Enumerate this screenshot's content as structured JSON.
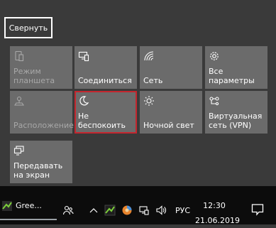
{
  "collapse_label": "Свернуть",
  "tiles": [
    {
      "label": "Режим планшета",
      "icon": "tablet-mode-icon",
      "disabled": true
    },
    {
      "label": "Соединиться",
      "icon": "connect-icon",
      "disabled": false
    },
    {
      "label": "Сеть",
      "icon": "network-icon",
      "disabled": false
    },
    {
      "label": "Все параметры",
      "icon": "settings-gear-icon",
      "disabled": false
    },
    {
      "label": "Расположение",
      "icon": "location-icon",
      "disabled": true
    },
    {
      "label": "Не беспокоить",
      "icon": "moon-icon",
      "disabled": false,
      "selected": true
    },
    {
      "label": "Ночной свет",
      "icon": "brightness-icon",
      "disabled": false
    },
    {
      "label": "Виртуальная сеть (VPN)",
      "icon": "vpn-icon",
      "disabled": false
    },
    {
      "label": "Передавать на экран",
      "icon": "project-icon",
      "disabled": false
    }
  ],
  "colors": {
    "tile_bg": "#6b6b6b",
    "panel_bg": "#3a3a3a",
    "selection_border": "#c4262e",
    "taskbar_bg": "#0c0c0c"
  },
  "taskbar": {
    "app_name": "Gree...",
    "language": "РУС",
    "time": "12:30",
    "date": "21.06.2019"
  }
}
